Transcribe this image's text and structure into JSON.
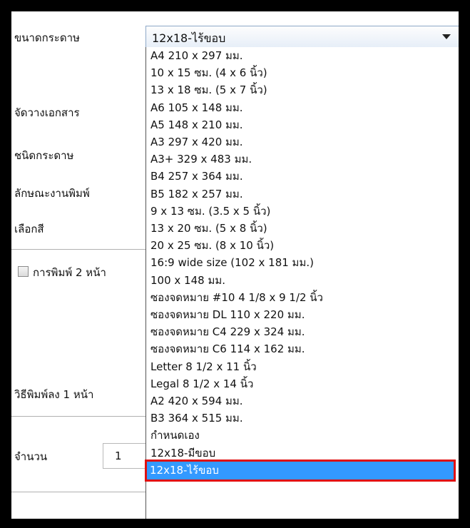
{
  "form": {
    "paper_size_label": "ขนาดกระดาษ",
    "orientation_label": "จัดวางเอกสาร",
    "paper_type_label": "ชนิดกระดาษ",
    "print_quality_label": "ลักษณะงานพิมพ์",
    "color_label": "เลือกสี",
    "duplex_label": "การพิมพ์ 2 หน้า",
    "pages_per_sheet_label": "วิธีพิมพ์ลง 1 หน้า",
    "copies_label": "จำนวน",
    "copies_value": "1"
  },
  "combo": {
    "selected": "12x18-ไร้ขอบ"
  },
  "options": [
    "A4 210 x 297 มม.",
    "10 x 15 ซม. (4 x 6 นิ้ว)",
    "13 x 18 ซม. (5 x 7 นิ้ว)",
    "A6 105 x 148 มม.",
    "A5 148 x 210 มม.",
    "A3 297 x 420 มม.",
    "A3+ 329 x 483 มม.",
    "B4 257 x 364 มม.",
    "B5 182 x 257 มม.",
    "9 x 13 ซม. (3.5 x 5 นิ้ว)",
    "13 x 20 ซม. (5 x 8 นิ้ว)",
    "20 x 25 ซม. (8 x 10 นิ้ว)",
    "16:9 wide size (102 x 181 มม.)",
    "100 x 148 มม.",
    "ซองจดหมาย #10 4 1/8 x 9 1/2 นิ้ว",
    "ซองจดหมาย DL  110 x 220 มม.",
    "ซองจดหมาย C4  229 x 324 มม.",
    "ซองจดหมาย C6  114 x 162 มม.",
    "Letter 8 1/2 x 11 นิ้ว",
    "Legal 8 1/2 x 14 นิ้ว",
    "A2 420 x 594 มม.",
    "B3 364 x 515 มม.",
    "กำหนดเอง",
    "12x18-มีขอบ",
    "12x18-ไร้ขอบ"
  ],
  "selected_index": 24,
  "colors": {
    "highlight": "#3399ff",
    "annotation_border": "#e01010"
  }
}
